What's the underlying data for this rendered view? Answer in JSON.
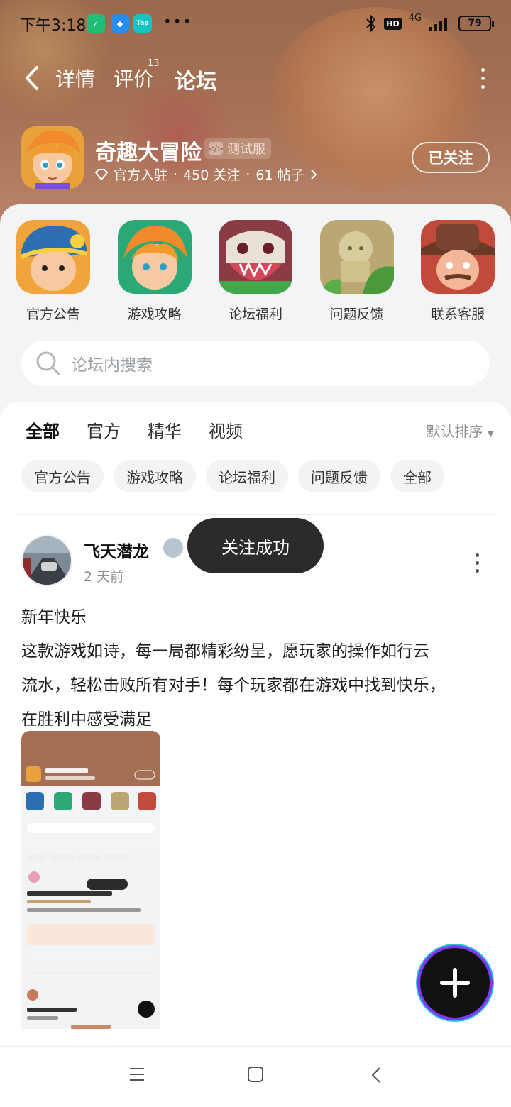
{
  "status_bar": {
    "time": "下午3:18",
    "dots": "•••",
    "network": "4G",
    "hd": "HD",
    "battery": "79"
  },
  "nav": {
    "tabs": [
      "详情",
      "评价",
      "论坛"
    ],
    "review_count": "13",
    "active_tab": "论坛"
  },
  "game": {
    "name": "奇趣大冒险",
    "tag": "测试服",
    "official": "官方入驻",
    "followers": "450 关注",
    "posts": "61 帖子",
    "follow_label": "已关注"
  },
  "shortcuts": [
    "官方公告",
    "游戏攻略",
    "论坛福利",
    "问题反馈",
    "联系客服"
  ],
  "search": {
    "placeholder": "论坛内搜索"
  },
  "filter": {
    "tabs": [
      "全部",
      "官方",
      "精华",
      "视频"
    ],
    "sort": "默认排序"
  },
  "chips": [
    "官方公告",
    "游戏攻略",
    "论坛福利",
    "问题反馈",
    "全部"
  ],
  "post": {
    "author": "飞天潜龙",
    "time": "2 天前",
    "lines": [
      "新年快乐",
      "这款游戏如诗，每一局都精彩纷呈，愿玩家的操作如行云",
      "流水，轻松击败所有对手！每个玩家都在游戏中找到快乐，",
      "在胜利中感受满足"
    ]
  },
  "toast": "关注成功",
  "colors": {
    "accent": "#20c7a3",
    "hero": "#a56f53"
  }
}
